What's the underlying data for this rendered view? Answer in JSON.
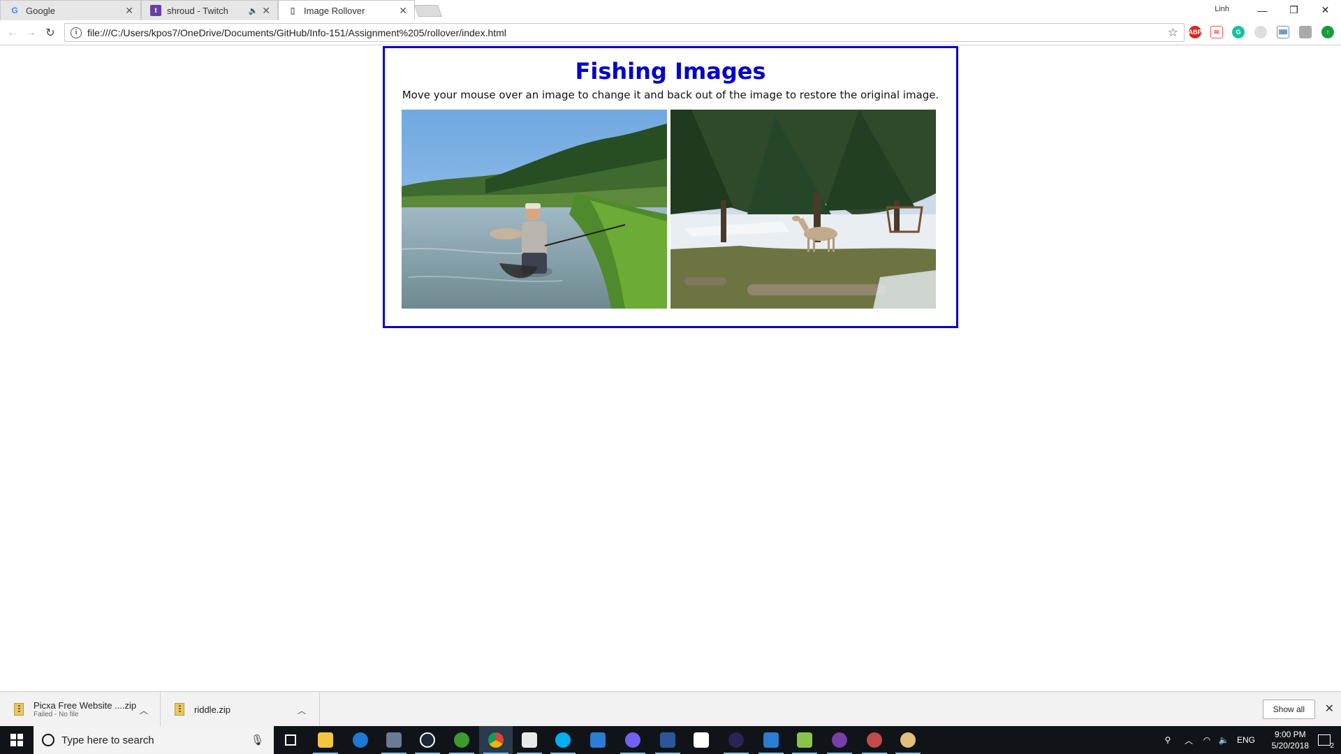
{
  "browser": {
    "tabs": [
      {
        "title": "Google",
        "favicon": "google-icon",
        "favicon_text": "G"
      },
      {
        "title": "shroud - Twitch",
        "favicon": "twitch-icon",
        "favicon_text": "t"
      },
      {
        "title": "Image Rollover",
        "favicon": "page-icon",
        "favicon_text": "▯"
      }
    ],
    "profile_name": "Linh",
    "url": "file:///C:/Users/kpos7/OneDrive/Documents/GitHub/Info-151/Assignment%205/rollover/index.html",
    "extensions": [
      "adblock-plus-icon",
      "pdf-icon",
      "grammarly-icon",
      "extension-icon",
      "keyboard-icon",
      "extension-icon",
      "update-icon"
    ]
  },
  "page": {
    "heading": "Fishing Images",
    "instructions": "Move your mouse over an image to change it and back out of the image to restore the original image.",
    "images": [
      {
        "alt": "angler holding fish in river"
      },
      {
        "alt": "deer in snowy campground"
      }
    ]
  },
  "downloads": {
    "items": [
      {
        "name": "Picxa Free Website ....zip",
        "status": "Failed - No file"
      },
      {
        "name": "riddle.zip",
        "status": ""
      }
    ],
    "show_all_label": "Show all"
  },
  "taskbar": {
    "search_placeholder": "Type here to search",
    "apps": [
      "task-view-icon",
      "file-explorer-icon",
      "edge-icon",
      "photo-app-icon",
      "steam-icon",
      "xbox-icon",
      "chrome-icon",
      "mail-icon",
      "skype-icon",
      "outlook-icon",
      "viber-icon",
      "word-icon",
      "store-icon",
      "eclipse-icon",
      "outlook-icon",
      "notepad-icon",
      "app-icon",
      "paint-icon",
      "paint-3d-icon"
    ],
    "tray": {
      "language": "ENG",
      "time": "9:00 PM",
      "date": "5/20/2018",
      "notification_count": "2"
    }
  }
}
